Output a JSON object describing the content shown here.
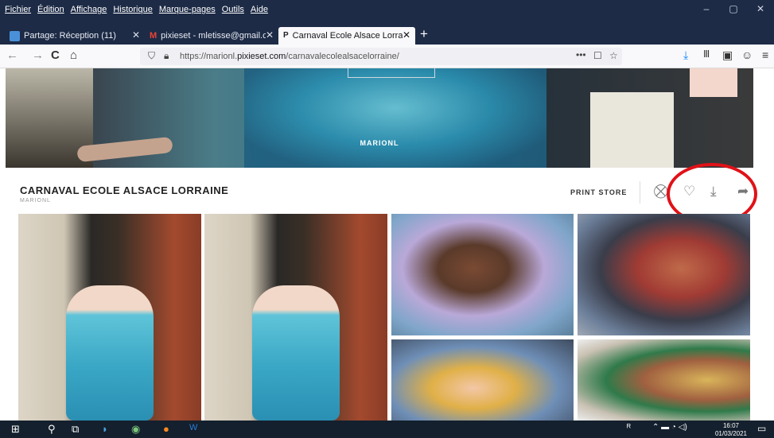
{
  "window": {
    "menu": [
      "Fichier",
      "Édition",
      "Affichage",
      "Historique",
      "Marque-pages",
      "Outils",
      "Aide"
    ],
    "controls": {
      "minimize": "–",
      "maximize": "▢",
      "close": "✕"
    }
  },
  "tabs": [
    {
      "label": "Partage: Réception (11)",
      "icon": "mail-icon",
      "close": "✕"
    },
    {
      "label": "pixieset - mletisse@gmail.com",
      "icon": "gmail-icon",
      "close": "✕"
    },
    {
      "label": "Carnaval Ecole Alsace Lorraine",
      "icon": "pixieset-icon",
      "close": "✕"
    }
  ],
  "new_tab": "+",
  "nav": {
    "back": "←",
    "forward": "→",
    "reload": "C",
    "home": "⌂",
    "url_prefix": "https://marionl.",
    "url_domain": "pixieset.com",
    "url_path": "/carnavalecolealsacelorraine/",
    "page_actions": "•••",
    "pocket": "☐",
    "bookmark": "☆",
    "download": "⤓",
    "library": "Ⅲ",
    "sidebar": "▣",
    "account": "☺",
    "menu": "≡"
  },
  "hero": {
    "studio": "MARIONL"
  },
  "gallery": {
    "title": "CARNAVAL ECOLE ALSACE LORRAINE",
    "subtitle": "MARIONL",
    "print_store": "PRINT STORE",
    "cart_icon": "⛒",
    "favorite_icon": "♡",
    "download_icon": "⤓",
    "share_icon": "➦"
  },
  "taskbar": {
    "time": "16:07",
    "date": "01/03/2021"
  },
  "colors": {
    "annotation_circle": "#e01218",
    "titlebar": "#1d2b46",
    "taskbar": "#14202e"
  }
}
